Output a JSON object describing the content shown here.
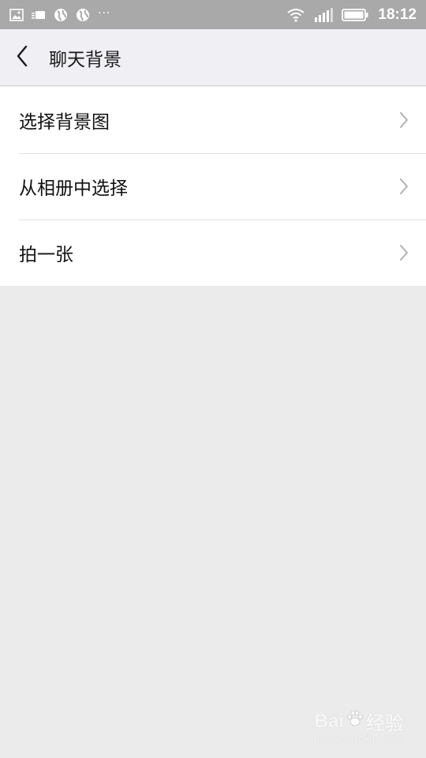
{
  "status_bar": {
    "time": "18:12",
    "left_icons": [
      "image-icon",
      "tag-icon",
      "globe-icon",
      "globe-icon",
      "more-dots-icon"
    ],
    "more_dots": "···",
    "right_icons": [
      "wifi-icon",
      "signal-icon",
      "battery-icon"
    ],
    "background": "#a9a9a9"
  },
  "header": {
    "back_icon": "back-arrow-icon",
    "title": "聊天背景"
  },
  "menu": {
    "items": [
      {
        "label": "选择背景图",
        "icon": "chevron-right-icon"
      },
      {
        "label": "从相册中选择",
        "icon": "chevron-right-icon"
      },
      {
        "label": "拍一张",
        "icon": "chevron-right-icon"
      }
    ]
  },
  "watermark": {
    "brand": "Bai",
    "brand_suffix": "经验",
    "url": "jingyan.baidu.com"
  },
  "colors": {
    "background": "#ebebeb",
    "header": "#efeff4",
    "list": "#ffffff",
    "text": "#111111",
    "chevron": "#b2b2b2"
  }
}
